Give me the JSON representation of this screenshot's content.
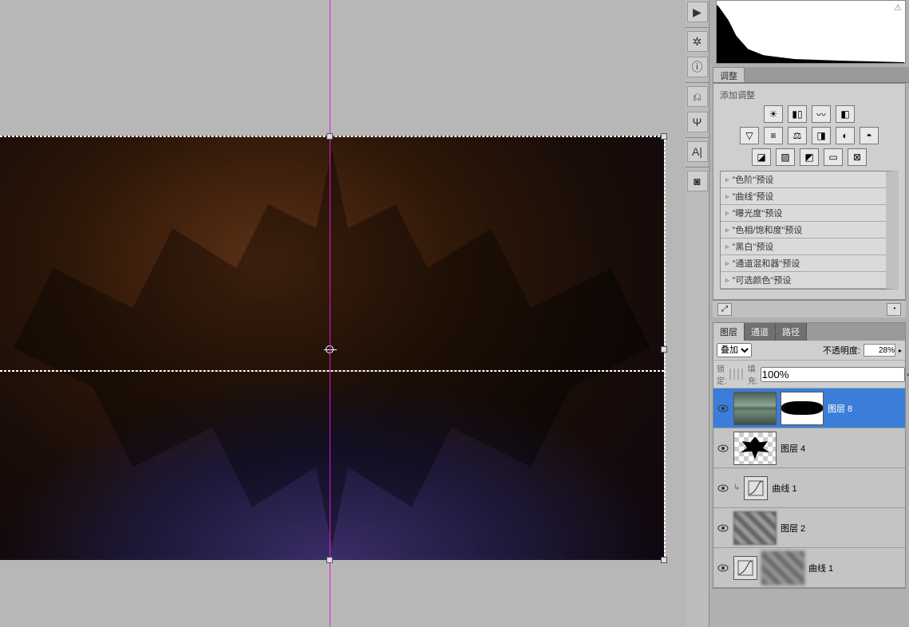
{
  "adjust_panel": {
    "tab": "调整",
    "add_label": "添加调整",
    "presets": [
      "\"色阶\"预设",
      "\"曲线\"预设",
      "\"曝光度\"预设",
      "\"色相/饱和度\"预设",
      "\"黑白\"预设",
      "\"通道混和器\"预设",
      "\"可选颜色\"预设"
    ]
  },
  "layers_panel": {
    "tabs": [
      "图层",
      "通道",
      "路径"
    ],
    "blend_label": "",
    "blend_mode": "叠加",
    "opacity_label": "不透明度:",
    "opacity_value": "28%",
    "lock_label": "锁定:",
    "fill_label": "填充:",
    "fill_value": "100%",
    "layers": [
      {
        "name": "图层 8"
      },
      {
        "name": "图层 4"
      },
      {
        "name": "曲线 1"
      },
      {
        "name": "图层 2"
      },
      {
        "name": "曲线 1"
      }
    ]
  }
}
